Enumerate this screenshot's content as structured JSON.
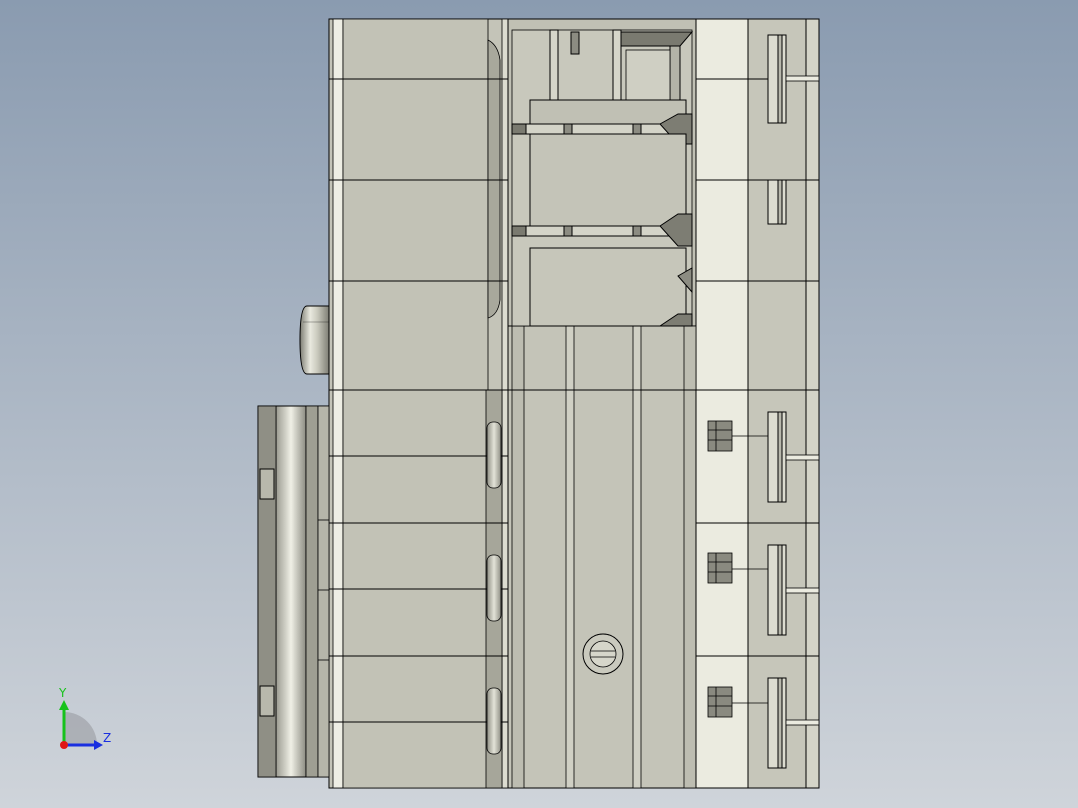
{
  "viewport": {
    "background_top": "#8a9bb0",
    "background_bottom": "#cfd4da"
  },
  "model": {
    "body_color": "#c4c4b8",
    "body_light": "#d8d8cc",
    "face_pale": "#ebebe0",
    "shadow_color": "#8a8a80",
    "edge_color": "#000000",
    "inner_shade": "#b0b0a4"
  },
  "triad": {
    "y_label": "Y",
    "z_label": "Z",
    "y_color": "#16c21b",
    "z_color": "#1a2fe0",
    "x_color": "#e01515"
  }
}
